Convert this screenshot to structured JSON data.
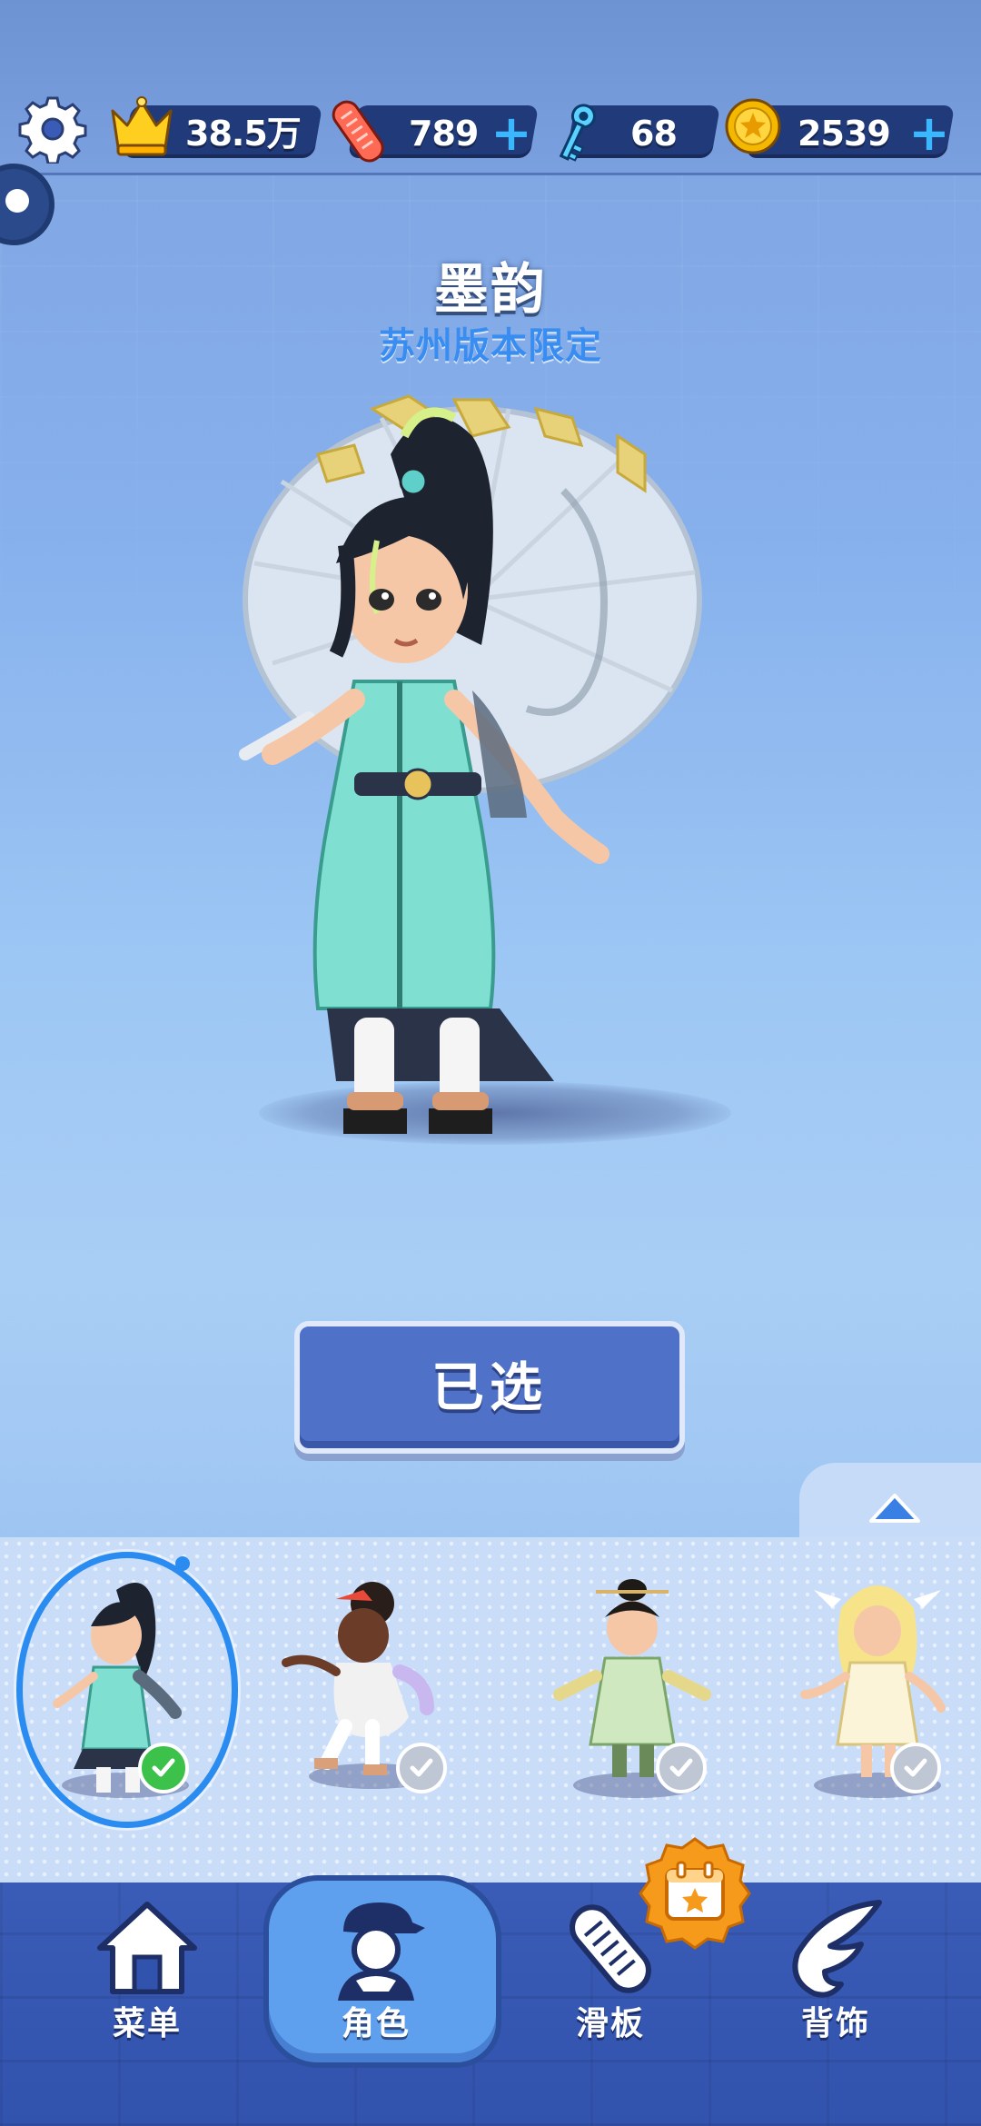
{
  "resources": {
    "crown_value": "38.5万",
    "board_value": "789",
    "key_value": "68",
    "coin_value": "2539",
    "plus_symbol": "+"
  },
  "character": {
    "name": "墨韵",
    "subtitle": "苏州版本限定"
  },
  "select_button": {
    "label": "已选"
  },
  "tray": {
    "slots": [
      {
        "name": "墨韵",
        "selected": true
      },
      {
        "name": "character-2",
        "selected": false
      },
      {
        "name": "character-3",
        "selected": false
      },
      {
        "name": "character-4",
        "selected": false
      }
    ]
  },
  "nav": {
    "items": [
      {
        "label": "菜单",
        "icon": "home-icon"
      },
      {
        "label": "角色",
        "icon": "character-icon",
        "active": true
      },
      {
        "label": "滑板",
        "icon": "skateboard-icon"
      },
      {
        "label": "背饰",
        "icon": "wing-icon"
      }
    ]
  },
  "colors": {
    "accent_blue": "#2a8cf0",
    "button_blue": "#4f72c8",
    "nav_blue": "#3253ad",
    "check_green": "#3cc24a",
    "coin_gold": "#f5b800",
    "badge_orange": "#f59a1b"
  }
}
